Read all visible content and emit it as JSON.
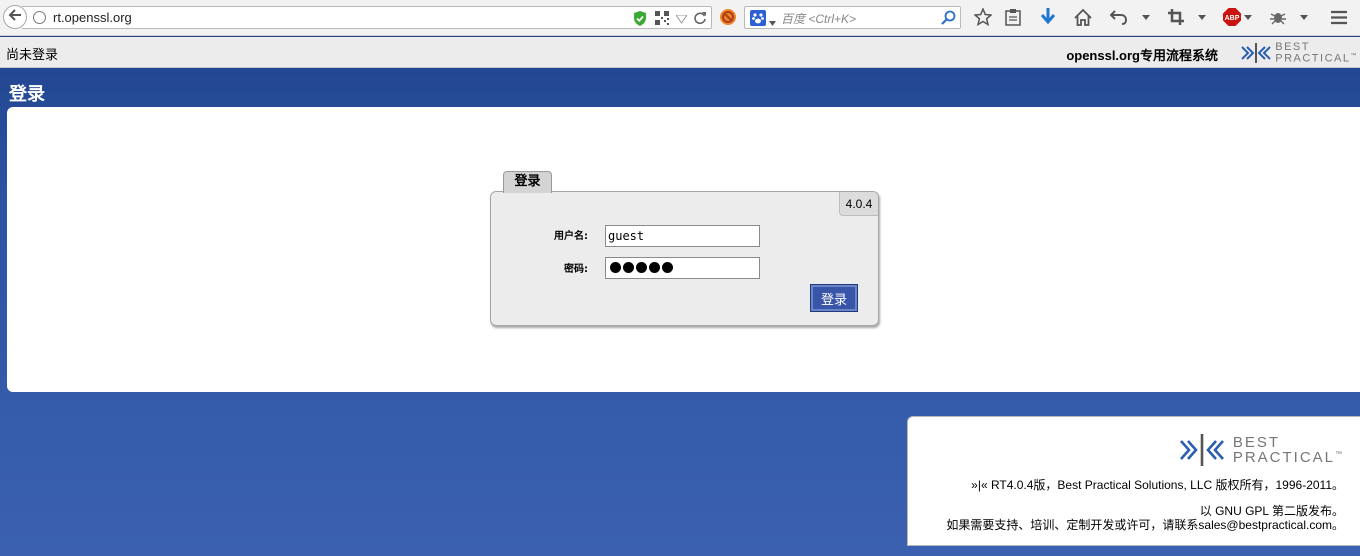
{
  "browser": {
    "url": "rt.openssl.org",
    "search_placeholder": "百度 <Ctrl+K>"
  },
  "topbar": {
    "status": "尚未登录",
    "system_name": "openssl.org专用流程系统",
    "logo_line1": "BEST",
    "logo_line2": "PRACTICAL",
    "logo_tm": "™"
  },
  "page": {
    "title": "登录"
  },
  "login": {
    "tab_label": "登录",
    "version": "4.0.4",
    "username_label": "用户名:",
    "username_value": "guest",
    "password_label": "密码:",
    "password_length": 5,
    "submit_label": "登录"
  },
  "footer": {
    "logo_line1": "BEST",
    "logo_line2": "PRACTICAL",
    "logo_tm": "™",
    "copyright": "»|« RT4.0.4版，Best Practical Solutions, LLC 版权所有，1996-2011。",
    "license": "以 GNU GPL 第二版发布。",
    "contact": "如果需要支持、培训、定制开发或许可，请联系sales@bestpractical.com。"
  },
  "colors": {
    "header_blue": "#1e4088",
    "button_blue": "#3855a8",
    "logo_blue": "#2a5fb0"
  }
}
